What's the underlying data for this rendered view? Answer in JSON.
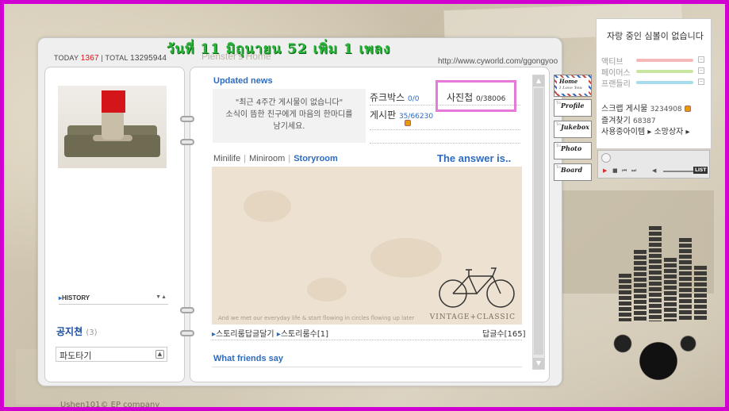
{
  "headline": "วันที่ 11 มิถุนายน 52 เพิ่ม 1 เพลง",
  "counter": {
    "today_label": "TODAY",
    "today_value": "1367",
    "total_label": "TOTAL",
    "total_value": "13295944"
  },
  "home_title": "Plenster's Home",
  "url": "http://www.cyworld.com/ggongyoo",
  "left": {
    "history_label": "HISTORY",
    "notice_title": "공지쳔",
    "notice_count": "(3)",
    "notice_select_value": "파도타기"
  },
  "updated": {
    "title": "Updated news",
    "message_line1": "\"최근 4주간 게시물이 없습니다\"",
    "message_line2": "소식이 뜸한 친구에게 마음의 한마디를",
    "message_line3": "남기세요."
  },
  "menu": {
    "jukebox_label": "쥬크박스",
    "jukebox_count": "0/0",
    "photo_label": "사진첩",
    "photo_count": "0/38006",
    "board_label": "게시판",
    "board_count": "35/66230"
  },
  "tabs": {
    "minilife": "Minilife",
    "miniroom": "Miniroom",
    "storyroom": "Storyroom"
  },
  "answer_title": "The answer is..",
  "story": {
    "caption": "And we met our everyday life & start flowing in circles flowing up later",
    "vintage": "VINTAGE+CLASSIC",
    "link1": "스토리룸답글달기",
    "link2": "스토리룸수",
    "link2_count": "[1]",
    "reply_label": "답글수",
    "reply_count": "[165]"
  },
  "friends_title": "What friends say",
  "side_tabs": {
    "home_line1": "Home",
    "home_line2": "I Love You",
    "profile": "Profile",
    "jukebox": "Jukebox",
    "photo": "Photo",
    "board": "Board",
    "tab_prefix": "To"
  },
  "widget": {
    "title": "자랑 중인 심볼이 없습니다",
    "families": [
      {
        "label": "액티브",
        "color": "#f5b8b8"
      },
      {
        "label": "페이머스",
        "color": "#c8e6a0"
      },
      {
        "label": "프랜들리",
        "color": "#a8dcea"
      }
    ],
    "scrap_label": "스크랩 게시물",
    "scrap_count": "3234908",
    "fav_label": "즐겨찾기",
    "fav_count": "68387",
    "links": "사용중아이템 ▸ 소망상자 ▸"
  },
  "player": {
    "list_label": "LIST"
  },
  "footer": "Ushen101© EP company"
}
